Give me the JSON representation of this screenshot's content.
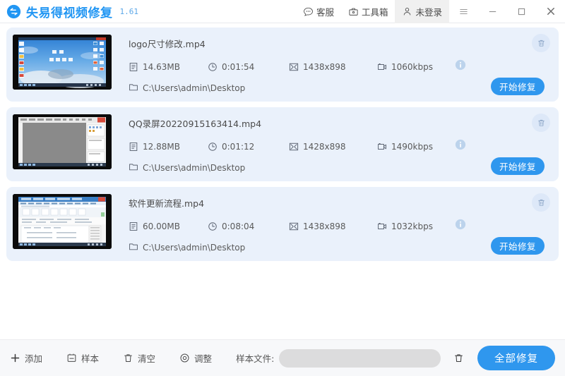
{
  "app": {
    "name": "失易得视频修复",
    "version": "1.61",
    "logo_icon": "recovery-arrow-logo"
  },
  "titlebar": {
    "items": [
      {
        "label": "客服",
        "icon": "chat-bubble-icon",
        "active": false
      },
      {
        "label": "工具箱",
        "icon": "toolbox-icon",
        "active": false
      },
      {
        "label": "未登录",
        "icon": "user-icon",
        "active": true
      }
    ],
    "window_controls": [
      {
        "name": "menu",
        "icon": "hamburger-icon"
      },
      {
        "name": "minimize",
        "icon": "minimize-icon"
      },
      {
        "name": "maximize",
        "icon": "maximize-icon"
      },
      {
        "name": "close",
        "icon": "close-icon"
      }
    ]
  },
  "files": [
    {
      "name": "logo尺寸修改.mp4",
      "size": "14.63MB",
      "duration": "0:01:54",
      "resolution": "1438x898",
      "bitrate": "1060kbps",
      "path": "C:\\Users\\admin\\Desktop",
      "repair_label": "开始修复",
      "thumbnail": "desktop-sky-wallpaper",
      "info_icon": "info-circle-icon",
      "delete_icon": "trash-icon"
    },
    {
      "name": "QQ录屏20220915163414.mp4",
      "size": "12.88MB",
      "duration": "0:01:12",
      "resolution": "1428x898",
      "bitrate": "1490kbps",
      "path": "C:\\Users\\admin\\Desktop",
      "repair_label": "开始修复",
      "thumbnail": "gray-editor-window",
      "info_icon": "info-circle-icon",
      "delete_icon": "trash-icon"
    },
    {
      "name": "软件更新流程.mp4",
      "size": "60.00MB",
      "duration": "0:08:04",
      "resolution": "1438x898",
      "bitrate": "1032kbps",
      "path": "C:\\Users\\admin\\Desktop",
      "repair_label": "开始修复",
      "thumbnail": "document-editor-window",
      "info_icon": "info-circle-icon",
      "delete_icon": "trash-icon"
    }
  ],
  "bottombar": {
    "add_label": "添加",
    "sample_label": "样本",
    "clear_label": "清空",
    "adjust_label": "调整",
    "sample_file_label": "样本文件:",
    "sample_file_value": "",
    "sample_file_placeholder": "",
    "repair_all_label": "全部修复",
    "icons": {
      "add": "plus-icon",
      "sample": "sample-box-icon",
      "clear": "trash-icon",
      "adjust": "target-icon",
      "sample_delete": "trash-icon"
    }
  },
  "colors": {
    "accent": "#2f97ee",
    "brand": "#2196f3",
    "row_bg": "#eaf1fb",
    "bottom_bg": "#f7f8fa"
  }
}
